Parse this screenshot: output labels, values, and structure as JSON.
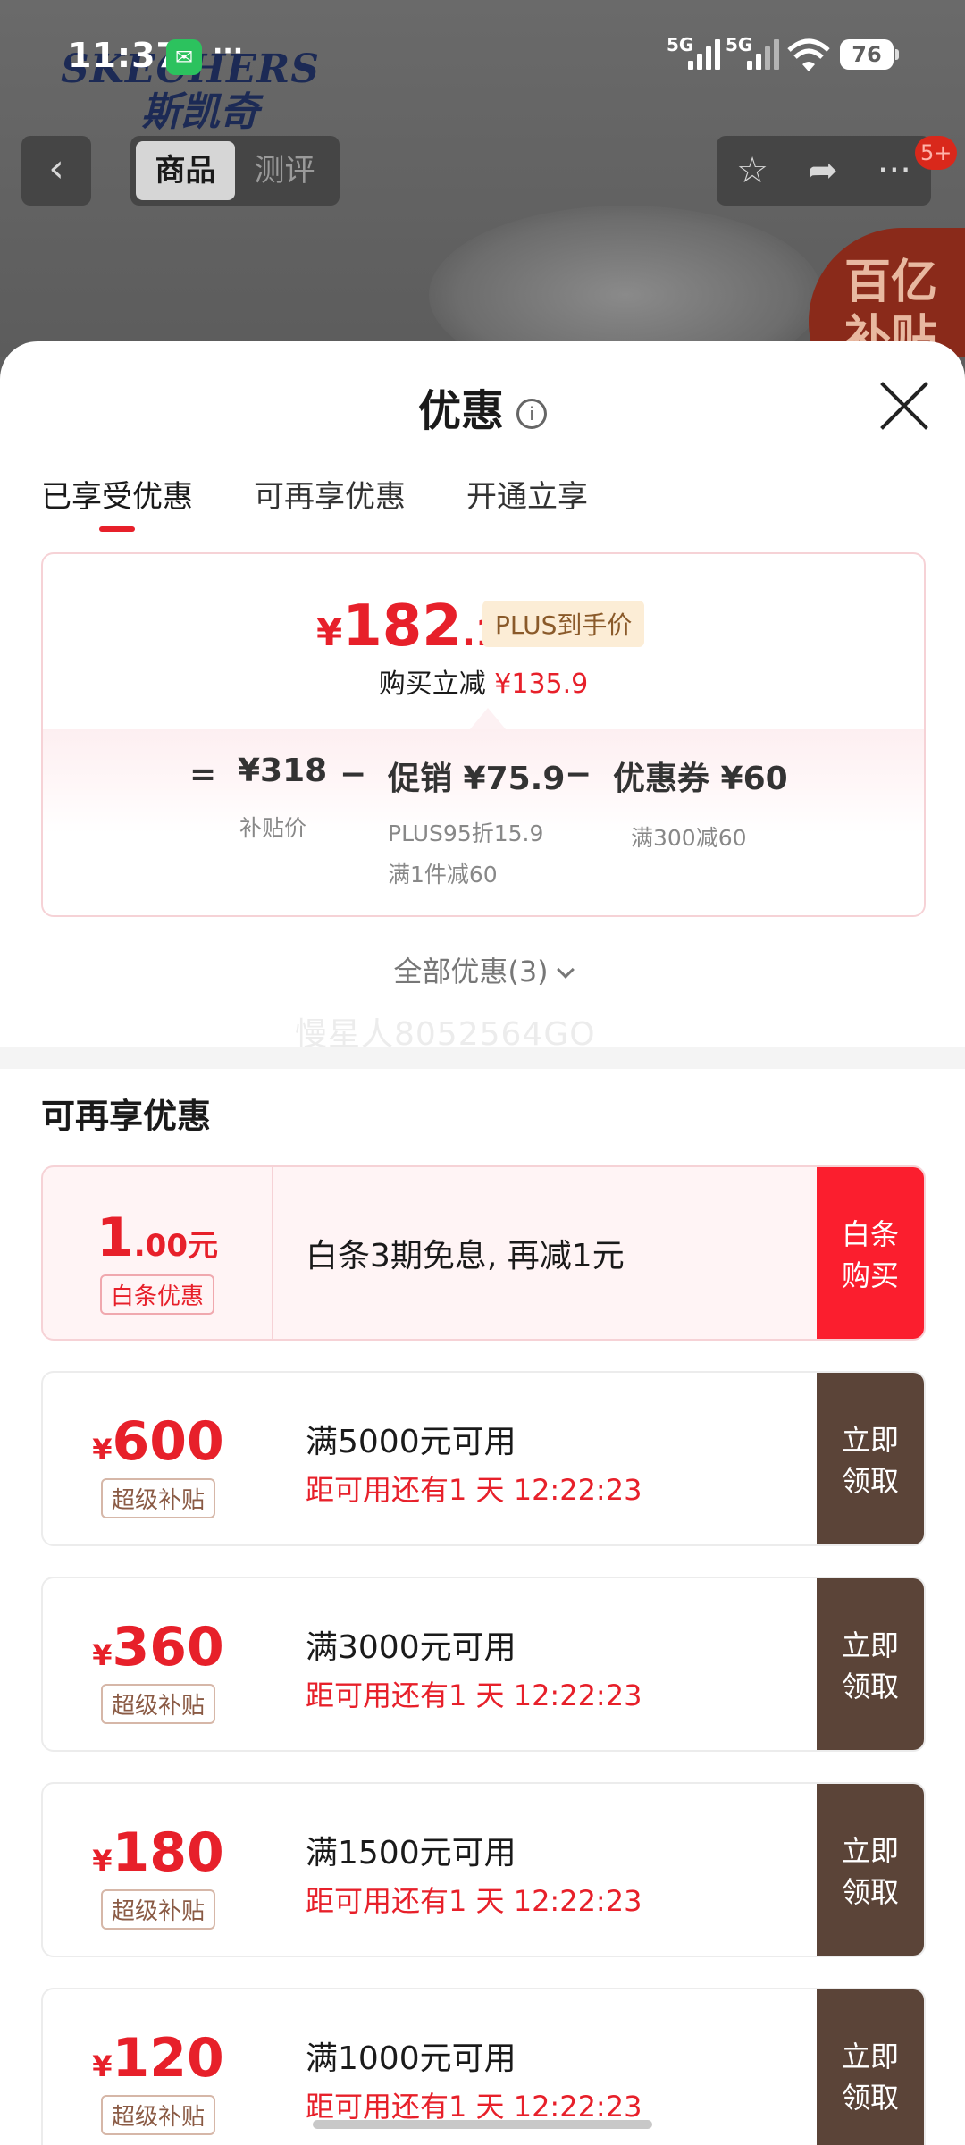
{
  "status_bar": {
    "time": "11:37",
    "app_icon": "wechat-icon",
    "dots": "···",
    "net1": "5G",
    "net2": "5G",
    "battery": "76"
  },
  "background": {
    "brand_en": "SKECHERS",
    "brand_zh": "斯凯奇",
    "badge_text": "百亿补贴"
  },
  "nav": {
    "back_icon": "‹",
    "seg_tabs": [
      "商品",
      "测评"
    ],
    "notification_count": "5+"
  },
  "sheet": {
    "title": "优惠",
    "info_icon": "i",
    "tabs": [
      "已享受优惠",
      "可再享优惠",
      "开通立享"
    ]
  },
  "price_summary": {
    "currency": "¥",
    "price_int": "182",
    "price_dec": ".1",
    "plus_label": "PLUS到手价",
    "instant_label": "购买立减",
    "instant_amount": "¥135.9",
    "equals": "=",
    "minus": "−",
    "subsidy_value": "¥318",
    "subsidy_label": "补贴价",
    "promo_value": "促销 ¥75.9",
    "promo_label_1": "PLUS95折15.9",
    "promo_label_2": "满1件减60",
    "coupon_value": "优惠券 ¥60",
    "coupon_label": "满300减60"
  },
  "all_offers": "全部优惠(3)",
  "watermark": "慢星人8052564GO",
  "section_title": "可再享优惠",
  "baitiao": {
    "amount_int": "1",
    "amount_dec": ".00元",
    "tag": "白条优惠",
    "desc": "白条3期免息, 再减1元",
    "action": [
      "白条",
      "购买"
    ]
  },
  "coupons": [
    {
      "currency": "¥",
      "amount": "600",
      "tag": "超级补贴",
      "title": "满5000元可用",
      "countdown": "距可用还有1 天 12:22:23",
      "action": [
        "立即",
        "领取"
      ]
    },
    {
      "currency": "¥",
      "amount": "360",
      "tag": "超级补贴",
      "title": "满3000元可用",
      "countdown": "距可用还有1 天 12:22:23",
      "action": [
        "立即",
        "领取"
      ]
    },
    {
      "currency": "¥",
      "amount": "180",
      "tag": "超级补贴",
      "title": "满1500元可用",
      "countdown": "距可用还有1 天 12:22:23",
      "action": [
        "立即",
        "领取"
      ]
    },
    {
      "currency": "¥",
      "amount": "120",
      "tag": "超级补贴",
      "title": "满1000元可用",
      "countdown": "距可用还有1 天 12:22:23",
      "action": [
        "立即",
        "领取"
      ]
    }
  ],
  "colors": {
    "accent_red": "#e7202a",
    "baitiao_red": "#fb1e2e",
    "action_brown": "#5b4438"
  }
}
